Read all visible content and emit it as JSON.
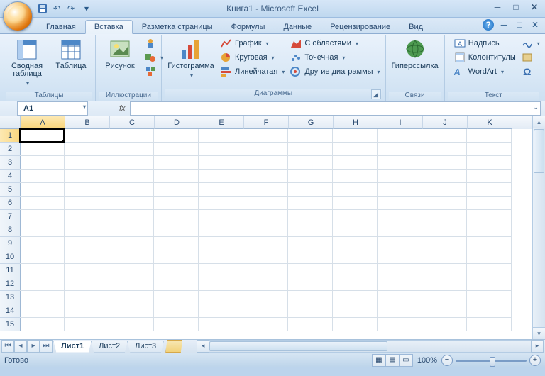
{
  "title": "Книга1 - Microsoft Excel",
  "qat": {
    "undo": "↶",
    "redo": "↷"
  },
  "tabs": [
    "Главная",
    "Вставка",
    "Разметка страницы",
    "Формулы",
    "Данные",
    "Рецензирование",
    "Вид"
  ],
  "active_tab": 1,
  "ribbon": {
    "groups": [
      {
        "label": "Таблицы",
        "big": [
          {
            "label": "Сводная таблица",
            "dd": true
          },
          {
            "label": "Таблица"
          }
        ]
      },
      {
        "label": "Иллюстрации",
        "big": [
          {
            "label": "Рисунок"
          }
        ]
      },
      {
        "label": "Диаграммы",
        "big": [
          {
            "label": "Гистограмма",
            "dd": true
          }
        ],
        "small": [
          [
            {
              "label": "График"
            },
            {
              "label": "Круговая"
            },
            {
              "label": "Линейчатая"
            }
          ],
          [
            {
              "label": "С областями"
            },
            {
              "label": "Точечная"
            },
            {
              "label": "Другие диаграммы"
            }
          ]
        ],
        "launcher": true
      },
      {
        "label": "Связи",
        "big": [
          {
            "label": "Гиперссылка"
          }
        ]
      },
      {
        "label": "Текст",
        "small": [
          [
            {
              "label": "Надпись"
            },
            {
              "label": "Колонтитулы"
            },
            {
              "label": "WordArt",
              "dd": true
            }
          ]
        ]
      }
    ]
  },
  "namebox": "A1",
  "fx": "fx",
  "columns": [
    "A",
    "B",
    "C",
    "D",
    "E",
    "F",
    "G",
    "H",
    "I",
    "J",
    "K"
  ],
  "rowcount": 15,
  "selected": {
    "col": 0,
    "row": 0
  },
  "sheets": [
    "Лист1",
    "Лист2",
    "Лист3"
  ],
  "active_sheet": 0,
  "status": "Готово",
  "zoom": "100%"
}
